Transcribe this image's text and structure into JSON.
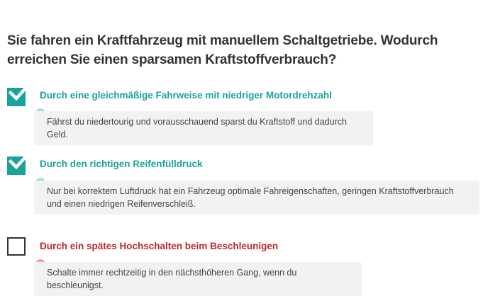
{
  "question": {
    "text": "Sie fahren ein Kraftfahrzeug mit manuellem Schaltgetriebe. Wodurch erreichen Sie einen sparsamen Kraftstoffverbrauch?"
  },
  "answers": [
    {
      "label": "Durch eine gleichmäßige Fahrweise mit niedriger Motordrehzahl",
      "checked": true,
      "status": "correct",
      "explanation": "Fährst du niedertourig und vorausschauend sparst du Kraftstoff und dadurch Geld."
    },
    {
      "label": "Durch den richtigen Reifenfülldruck",
      "checked": true,
      "status": "correct",
      "explanation": "Nur bei korrektem Luftdruck hat ein Fahrzeug optimale Fahreigenschaften, geringen Kraftstoffverbrauch und einen niedrigen Reifenverschleiß."
    },
    {
      "label": "Durch ein spätes Hochschalten beim Beschleunigen",
      "checked": false,
      "status": "wrong",
      "explanation": "Schalte immer rechtzeitig in den nächsthöheren Gang, wenn du beschleunigst."
    }
  ],
  "colors": {
    "correct": "#1aa39a",
    "wrong": "#c0272d",
    "text": "#333333",
    "explanation_bg": "#f2f2f2",
    "bubble_correct": "#a4dcd8",
    "bubble_wrong": "#f1a7aa"
  },
  "icons": {
    "checked": "checkmark-icon",
    "explanation": "speech-bubble-icon"
  }
}
